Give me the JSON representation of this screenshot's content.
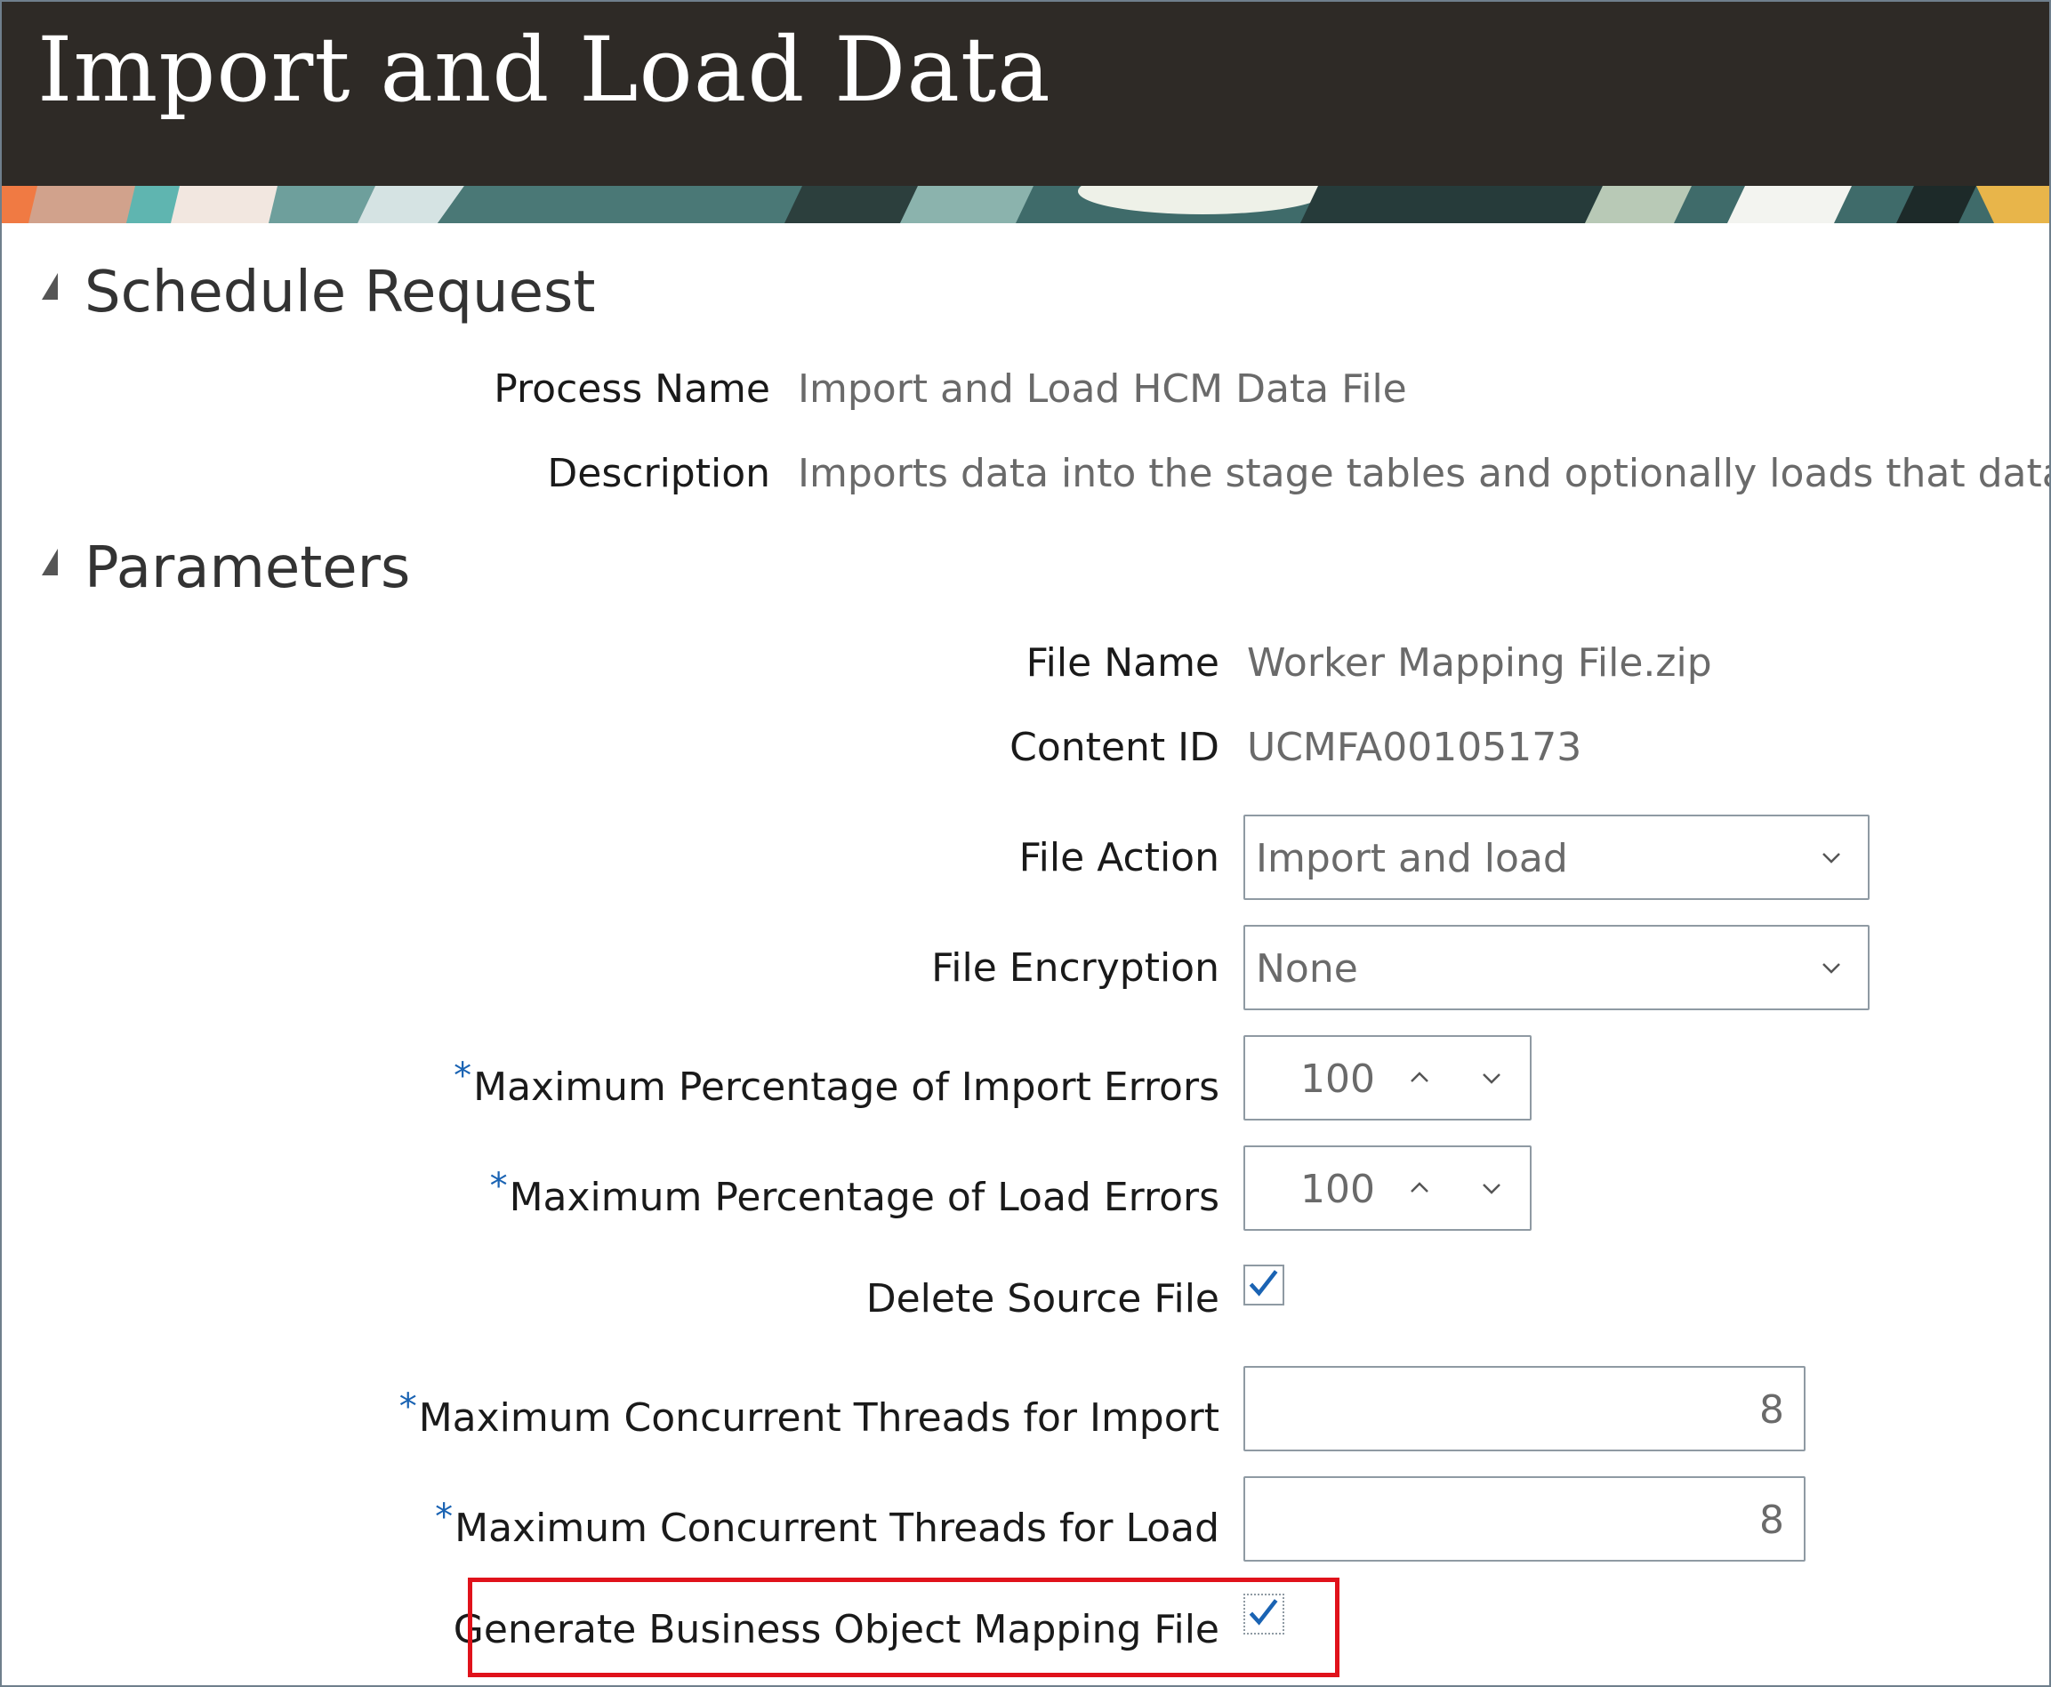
{
  "header": {
    "title": "Import and Load Data"
  },
  "schedule_request": {
    "title": "Schedule Request",
    "process_name_label": "Process Name",
    "process_name_value": "Import and Load HCM Data File",
    "description_label": "Description",
    "description_value": "Imports data into the stage tables and optionally loads that data in"
  },
  "parameters": {
    "title": "Parameters",
    "file_name_label": "File Name",
    "file_name_value": "Worker Mapping File.zip",
    "content_id_label": "Content ID",
    "content_id_value": "UCMFA00105173",
    "file_action_label": "File Action",
    "file_action_value": "Import and load",
    "file_encryption_label": "File Encryption",
    "file_encryption_value": "None",
    "required_marker": "*",
    "max_import_errors_label": "Maximum Percentage of Import Errors",
    "max_import_errors_value": "100",
    "max_load_errors_label": "Maximum Percentage of Load Errors",
    "max_load_errors_value": "100",
    "delete_source_label": "Delete Source File",
    "delete_source_checked": true,
    "threads_import_label": "Maximum Concurrent Threads for Import",
    "threads_import_value": "8",
    "threads_load_label": "Maximum Concurrent Threads for Load",
    "threads_load_value": "8",
    "generate_mapping_label": "Generate Business Object Mapping File",
    "generate_mapping_checked": true
  },
  "colors": {
    "header_bg": "#2e2a26",
    "required_marker": "#1a63b3",
    "checkmark": "#1a63b3",
    "highlight": "#e0121b"
  }
}
